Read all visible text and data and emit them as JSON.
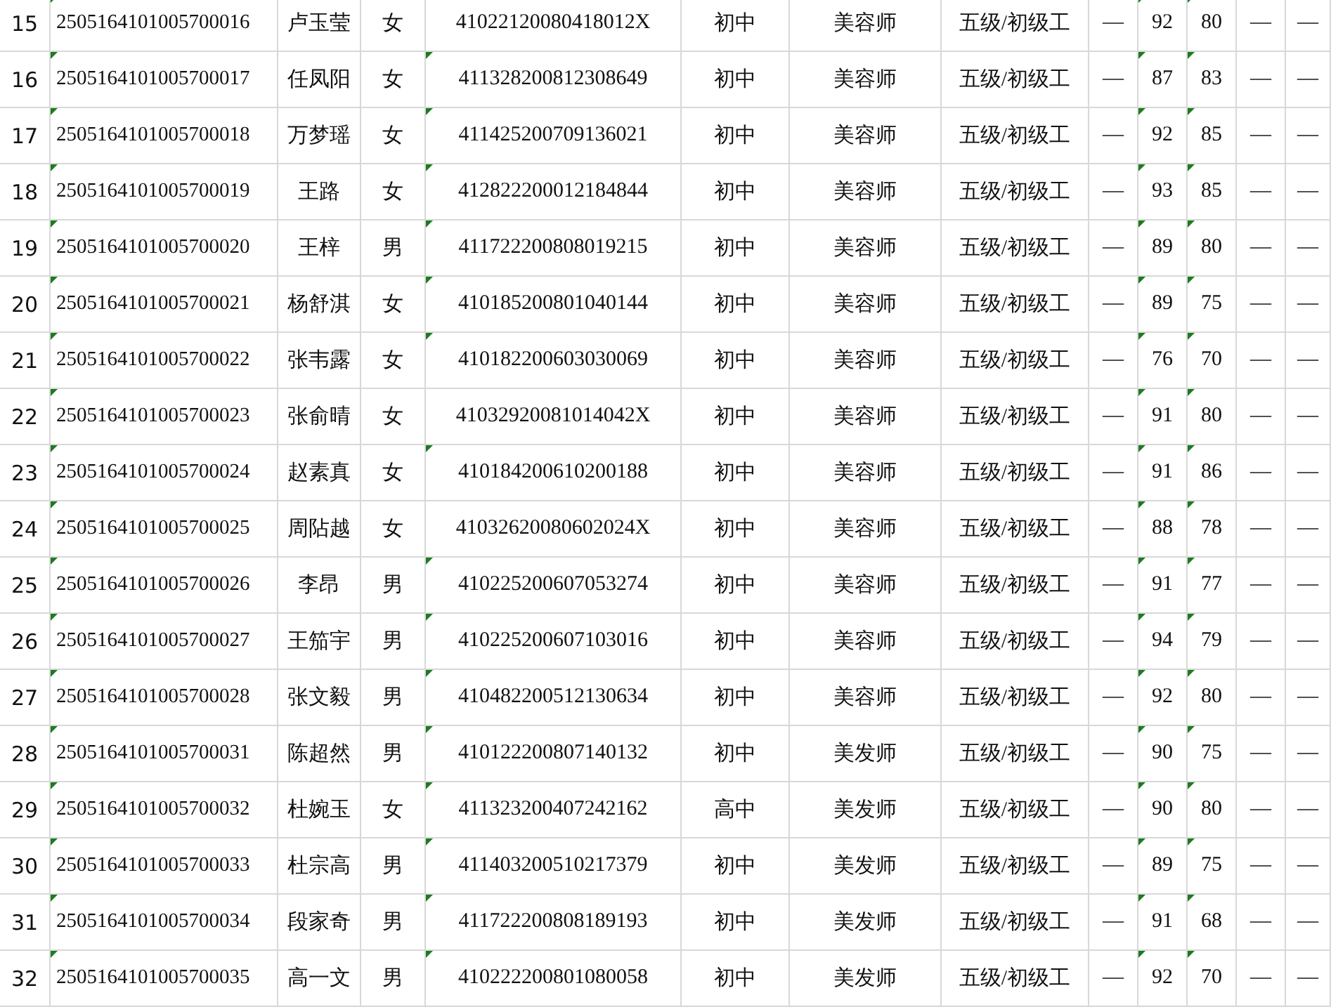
{
  "table": {
    "rows": [
      {
        "cells": [
          "15",
          "2505164101005700016",
          "卢玉莹",
          "女",
          "41022120080418012X",
          "初中",
          "美容师",
          "五级/初级工",
          "—",
          "92",
          "80",
          "—",
          "—"
        ],
        "id_marked": true,
        "id_card_marked": false,
        "score_1_marked": true,
        "score_2_marked": true
      },
      {
        "cells": [
          "16",
          "2505164101005700017",
          "任凤阳",
          "女",
          "411328200812308649",
          "初中",
          "美容师",
          "五级/初级工",
          "—",
          "87",
          "83",
          "—",
          "—"
        ],
        "id_marked": true,
        "id_card_marked": true,
        "score_1_marked": true,
        "score_2_marked": true
      },
      {
        "cells": [
          "17",
          "2505164101005700018",
          "万梦瑶",
          "女",
          "411425200709136021",
          "初中",
          "美容师",
          "五级/初级工",
          "—",
          "92",
          "85",
          "—",
          "—"
        ],
        "id_marked": true,
        "id_card_marked": true,
        "score_1_marked": true,
        "score_2_marked": true
      },
      {
        "cells": [
          "18",
          "2505164101005700019",
          "王路",
          "女",
          "412822200012184844",
          "初中",
          "美容师",
          "五级/初级工",
          "—",
          "93",
          "85",
          "—",
          "—"
        ],
        "id_marked": true,
        "id_card_marked": true,
        "score_1_marked": true,
        "score_2_marked": true
      },
      {
        "cells": [
          "19",
          "2505164101005700020",
          "王梓",
          "男",
          "411722200808019215",
          "初中",
          "美容师",
          "五级/初级工",
          "—",
          "89",
          "80",
          "—",
          "—"
        ],
        "id_marked": true,
        "id_card_marked": true,
        "score_1_marked": true,
        "score_2_marked": true
      },
      {
        "cells": [
          "20",
          "2505164101005700021",
          "杨舒淇",
          "女",
          "410185200801040144",
          "初中",
          "美容师",
          "五级/初级工",
          "—",
          "89",
          "75",
          "—",
          "—"
        ],
        "id_marked": true,
        "id_card_marked": true,
        "score_1_marked": true,
        "score_2_marked": true
      },
      {
        "cells": [
          "21",
          "2505164101005700022",
          "张韦露",
          "女",
          "410182200603030069",
          "初中",
          "美容师",
          "五级/初级工",
          "—",
          "76",
          "70",
          "—",
          "—"
        ],
        "id_marked": true,
        "id_card_marked": true,
        "score_1_marked": true,
        "score_2_marked": true
      },
      {
        "cells": [
          "22",
          "2505164101005700023",
          "张俞晴",
          "女",
          "41032920081014042X",
          "初中",
          "美容师",
          "五级/初级工",
          "—",
          "91",
          "80",
          "—",
          "—"
        ],
        "id_marked": true,
        "id_card_marked": false,
        "score_1_marked": true,
        "score_2_marked": true
      },
      {
        "cells": [
          "23",
          "2505164101005700024",
          "赵素真",
          "女",
          "410184200610200188",
          "初中",
          "美容师",
          "五级/初级工",
          "—",
          "91",
          "86",
          "—",
          "—"
        ],
        "id_marked": true,
        "id_card_marked": true,
        "score_1_marked": true,
        "score_2_marked": true
      },
      {
        "cells": [
          "24",
          "2505164101005700025",
          "周阽越",
          "女",
          "41032620080602024X",
          "初中",
          "美容师",
          "五级/初级工",
          "—",
          "88",
          "78",
          "—",
          "—"
        ],
        "id_marked": true,
        "id_card_marked": false,
        "score_1_marked": true,
        "score_2_marked": true
      },
      {
        "cells": [
          "25",
          "2505164101005700026",
          "李昂",
          "男",
          "410225200607053274",
          "初中",
          "美容师",
          "五级/初级工",
          "—",
          "91",
          "77",
          "—",
          "—"
        ],
        "id_marked": true,
        "id_card_marked": true,
        "score_1_marked": true,
        "score_2_marked": true
      },
      {
        "cells": [
          "26",
          "2505164101005700027",
          "王笳宇",
          "男",
          "410225200607103016",
          "初中",
          "美容师",
          "五级/初级工",
          "—",
          "94",
          "79",
          "—",
          "—"
        ],
        "id_marked": true,
        "id_card_marked": true,
        "score_1_marked": true,
        "score_2_marked": true
      },
      {
        "cells": [
          "27",
          "2505164101005700028",
          "张文毅",
          "男",
          "410482200512130634",
          "初中",
          "美容师",
          "五级/初级工",
          "—",
          "92",
          "80",
          "—",
          "—"
        ],
        "id_marked": true,
        "id_card_marked": true,
        "score_1_marked": true,
        "score_2_marked": true
      },
      {
        "cells": [
          "28",
          "2505164101005700031",
          "陈超然",
          "男",
          "410122200807140132",
          "初中",
          "美发师",
          "五级/初级工",
          "—",
          "90",
          "75",
          "—",
          "—"
        ],
        "id_marked": true,
        "id_card_marked": true,
        "score_1_marked": true,
        "score_2_marked": true
      },
      {
        "cells": [
          "29",
          "2505164101005700032",
          "杜婉玉",
          "女",
          "411323200407242162",
          "高中",
          "美发师",
          "五级/初级工",
          "—",
          "90",
          "80",
          "—",
          "—"
        ],
        "id_marked": true,
        "id_card_marked": true,
        "score_1_marked": true,
        "score_2_marked": true
      },
      {
        "cells": [
          "30",
          "2505164101005700033",
          "杜宗高",
          "男",
          "411403200510217379",
          "初中",
          "美发师",
          "五级/初级工",
          "—",
          "89",
          "75",
          "—",
          "—"
        ],
        "id_marked": true,
        "id_card_marked": true,
        "score_1_marked": true,
        "score_2_marked": true
      },
      {
        "cells": [
          "31",
          "2505164101005700034",
          "段家奇",
          "男",
          "411722200808189193",
          "初中",
          "美发师",
          "五级/初级工",
          "—",
          "91",
          "68",
          "—",
          "—"
        ],
        "id_marked": true,
        "id_card_marked": true,
        "score_1_marked": true,
        "score_2_marked": true
      },
      {
        "cells": [
          "32",
          "2505164101005700035",
          "高一文",
          "男",
          "410222200801080058",
          "初中",
          "美发师",
          "五级/初级工",
          "—",
          "92",
          "70",
          "—",
          "—"
        ],
        "id_marked": true,
        "id_card_marked": true,
        "score_1_marked": true,
        "score_2_marked": true
      }
    ]
  }
}
